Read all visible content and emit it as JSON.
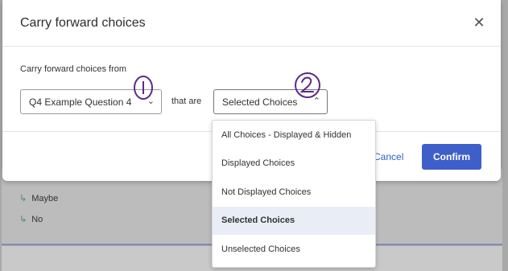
{
  "background": {
    "choices": [
      {
        "label": "Maybe"
      },
      {
        "label": "No"
      }
    ]
  },
  "modal": {
    "title": "Carry forward choices",
    "close_label": "✕",
    "from_label": "Carry forward choices from",
    "question_select": {
      "value": "Q4 Example Question 4"
    },
    "that_are_label": "that are",
    "which_select": {
      "value": "Selected Choices"
    },
    "cancel_label": "Cancel",
    "confirm_label": "Confirm"
  },
  "dropdown": {
    "options": [
      {
        "label": "All Choices - Displayed & Hidden"
      },
      {
        "label": "Displayed Choices"
      },
      {
        "label": "Not Displayed Choices"
      },
      {
        "label": "Selected Choices",
        "selected": true
      },
      {
        "label": "Unselected Choices"
      }
    ]
  },
  "colors": {
    "accent": "#3e5fc9",
    "link": "#2d63c8",
    "selected_bg": "#e9eef6",
    "annotation": "#5a2b8a"
  }
}
